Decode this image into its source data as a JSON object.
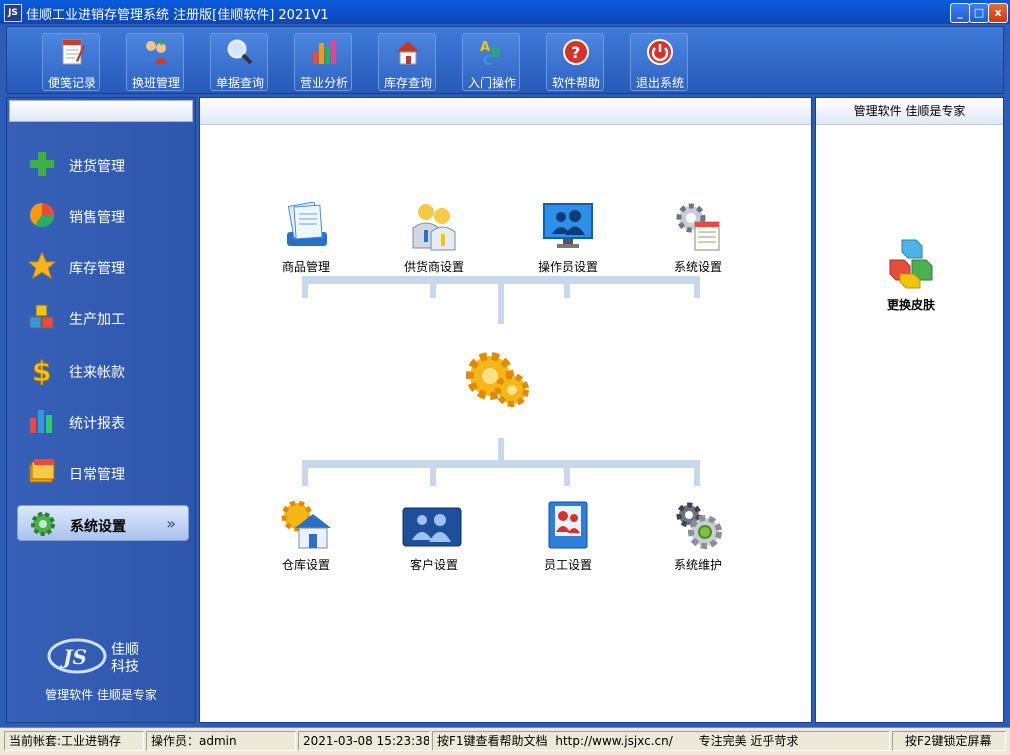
{
  "window": {
    "icon_text": "JS",
    "title": "佳顺工业进销存管理系统 注册版[佳顺软件] 2021V1",
    "controls": {
      "minimize": "_",
      "maximize": "□",
      "close": "x"
    }
  },
  "toolbar": {
    "items": [
      {
        "label": "便笺记录",
        "icon": "notepad-icon"
      },
      {
        "label": "换班管理",
        "icon": "users-swap-icon"
      },
      {
        "label": "单据查询",
        "icon": "magnifier-icon"
      },
      {
        "label": "营业分析",
        "icon": "bar-chart-icon"
      },
      {
        "label": "库存查询",
        "icon": "house-icon"
      },
      {
        "label": "入门操作",
        "icon": "abc-icon"
      },
      {
        "label": "软件帮助",
        "icon": "help-icon"
      },
      {
        "label": "退出系统",
        "icon": "power-icon"
      }
    ]
  },
  "sidebar": {
    "items": [
      {
        "label": "进货管理",
        "icon": "plus-icon"
      },
      {
        "label": "销售管理",
        "icon": "pie-icon"
      },
      {
        "label": "库存管理",
        "icon": "star-icon"
      },
      {
        "label": "生产加工",
        "icon": "cubes-icon"
      },
      {
        "label": "往来帐款",
        "icon": "dollar-icon"
      },
      {
        "label": "统计报表",
        "icon": "bars-icon"
      },
      {
        "label": "日常管理",
        "icon": "folders-icon"
      },
      {
        "label": "系统设置",
        "icon": "gear-icon",
        "active": true,
        "chevron": "»"
      }
    ],
    "logo": {
      "mark": "JS",
      "name_line1": "佳顺",
      "name_line2": "科技"
    },
    "slogan": "管理软件 佳顺是专家"
  },
  "main": {
    "top_items": [
      {
        "label": "商品管理",
        "icon": "documents-icon"
      },
      {
        "label": "供货商设置",
        "icon": "suppliers-icon"
      },
      {
        "label": "操作员设置",
        "icon": "operators-icon"
      },
      {
        "label": "系统设置",
        "icon": "settings-sheet-icon"
      }
    ],
    "center_icon": "gears-icon",
    "bottom_items": [
      {
        "label": "仓库设置",
        "icon": "warehouse-icon"
      },
      {
        "label": "客户设置",
        "icon": "customers-icon"
      },
      {
        "label": "员工设置",
        "icon": "employees-icon"
      },
      {
        "label": "系统维护",
        "icon": "maintenance-icon"
      }
    ]
  },
  "right_panel": {
    "header": "管理软件 佳顺是专家",
    "skin_label": "更换皮肤",
    "skin_icon": "cubes-color-icon"
  },
  "statusbar": {
    "account": "当前帐套:工业进销存",
    "operator": "操作员：admin",
    "datetime": "2021-03-08 15:23:38",
    "help": "按F1键查看帮助文档",
    "url": "http://www.jsjxc.cn/",
    "motto": "专注完美 近乎苛求",
    "lock": "按F2键锁定屏幕"
  },
  "colors": {
    "title_bar": "#0b4fc7",
    "panel_blue": "#2e56ac",
    "status_bg": "#ece9d8"
  }
}
